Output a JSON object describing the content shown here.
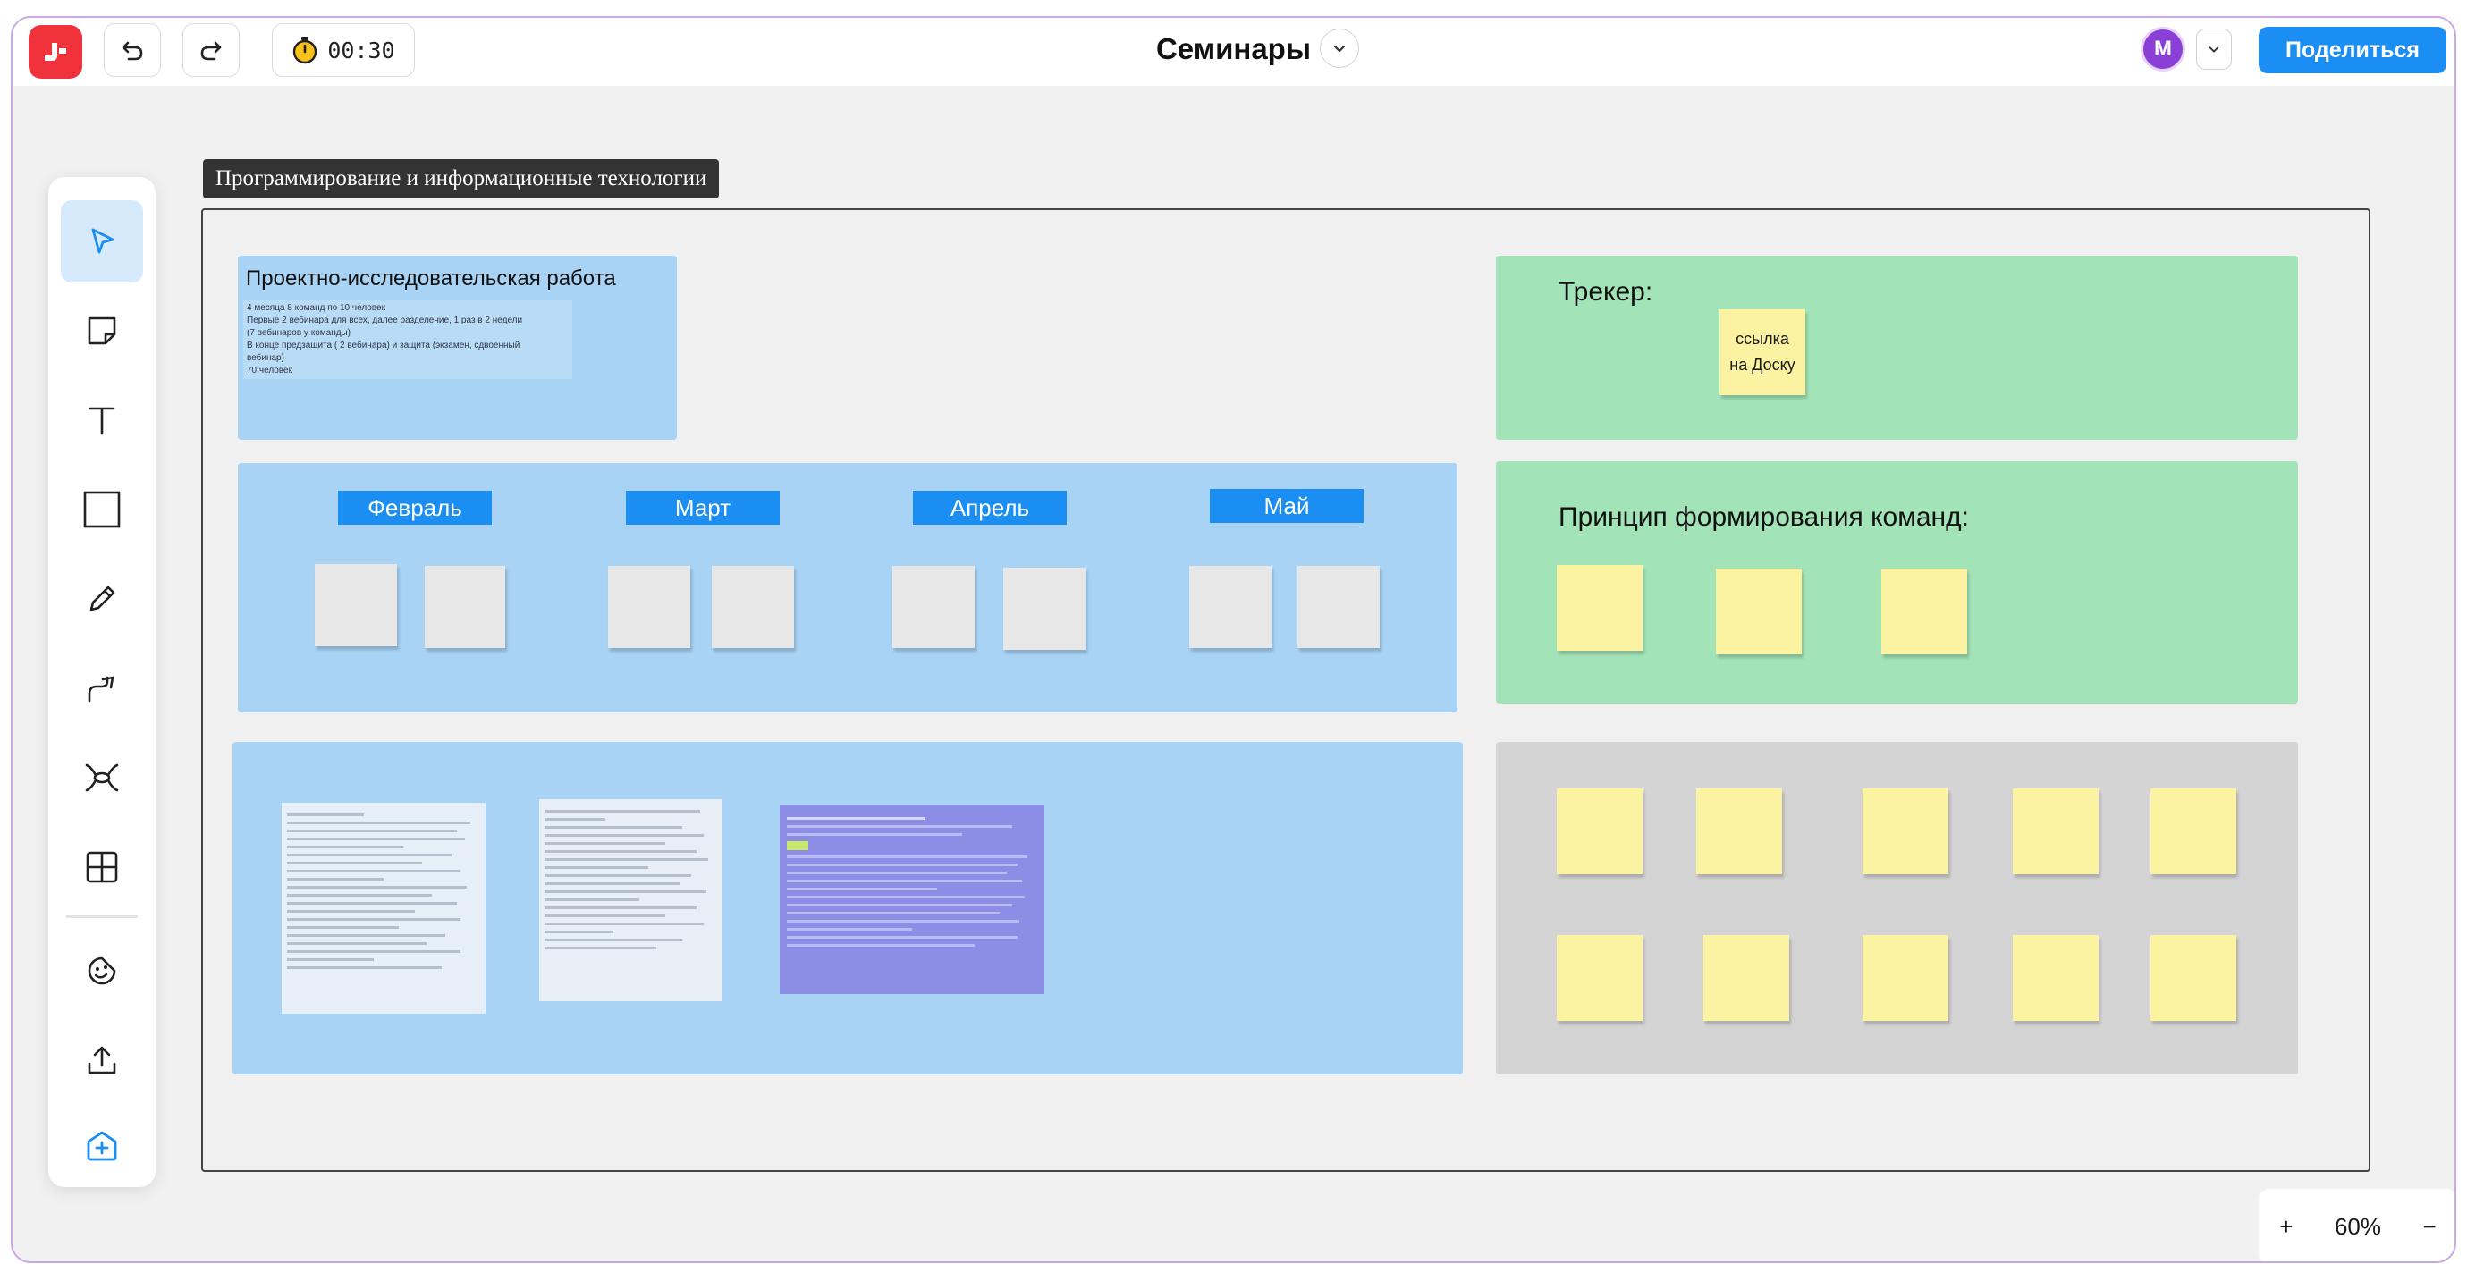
{
  "topbar": {
    "timer": "00:30",
    "board_title": "Семинары",
    "avatar_initial": "M",
    "share_label": "Поделиться"
  },
  "toolbar": {
    "tools": [
      "select-tool",
      "sticky-note-tool",
      "text-tool",
      "shape-tool",
      "pen-tool",
      "connector-tool",
      "mindmap-tool",
      "table-tool",
      "stickers-tool",
      "upload-tool",
      "templates-tool"
    ]
  },
  "frame": {
    "label": "Программирование и информационные технологии"
  },
  "project": {
    "title": "Проектно-исследовательская работа",
    "lines": [
      "4 месяца 8 команд по 10 человек",
      "Первые 2 вебинара для всех, далее разделение, 1 раз в 2 недели",
      "(7 вебинаров у команды)",
      "В конце предзащита ( 2 вебинара) и защита (экзамен, сдвоенный",
      "вебинар)",
      "70 человек"
    ]
  },
  "months": [
    "Февраль",
    "Март",
    "Апрель",
    "Май"
  ],
  "tracker": {
    "title": "Трекер:",
    "sticky_text": "ссылка на Доску"
  },
  "teams": {
    "title": "Принцип формирования команд:"
  },
  "accent_colors": {
    "blue_panel": "#a8d3f5",
    "green_panel": "#a2e4b8",
    "gray_panel": "#d4d4d4",
    "sticky_yellow": "#fbf3a1",
    "brand_blue": "#1a8ef2",
    "logo_red": "#f0323c"
  },
  "zoom": {
    "plus": "+",
    "value": "60%",
    "minus": "−"
  }
}
